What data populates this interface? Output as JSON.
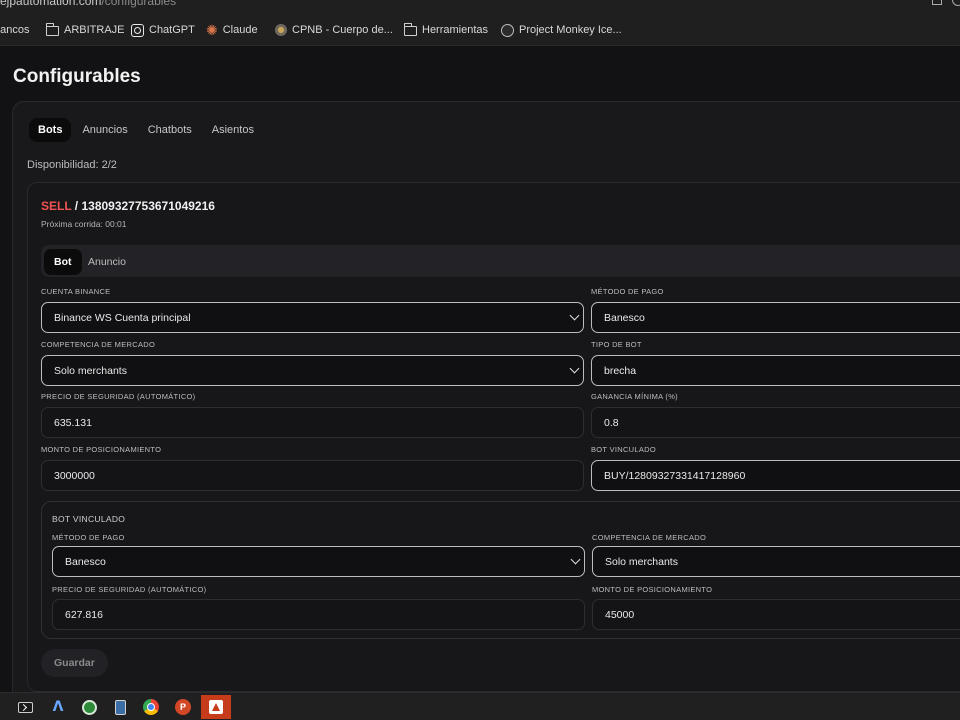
{
  "browser": {
    "url_main": "ejpautomation.com",
    "url_path": "/configurables",
    "bookmarks": [
      {
        "icon": "folder-icon",
        "label": "bancos"
      },
      {
        "icon": "folder-icon",
        "label": "ARBITRAJE"
      },
      {
        "icon": "chatgpt-icon",
        "label": "ChatGPT"
      },
      {
        "icon": "claude-icon",
        "label": "Claude"
      },
      {
        "icon": "cpnb-icon",
        "label": "CPNB - Cuerpo de..."
      },
      {
        "icon": "folder-icon",
        "label": "Herramientas"
      },
      {
        "icon": "project-monkey-icon",
        "label": "Project Monkey Ice..."
      }
    ]
  },
  "page": {
    "title": "Configurables",
    "tabs": [
      "Bots",
      "Anuncios",
      "Chatbots",
      "Asientos"
    ],
    "active_tab": "Bots",
    "availability": "Disponibilidad: 2/2"
  },
  "bot": {
    "side": "SELL",
    "separator": " / ",
    "id": "1380932775367104921​6",
    "next_run": "Próxima corrida: 00:01",
    "subtabs": [
      "Bot",
      "Anuncio"
    ],
    "active_subtab": "Bot",
    "form": {
      "cuenta_binance": {
        "label": "Cuenta Binance",
        "value": "Binance WS Cuenta principal"
      },
      "metodo_pago": {
        "label": "Método de pago",
        "value": "Banesco"
      },
      "competencia": {
        "label": "Competencia de mercado",
        "value": "Solo merchants"
      },
      "tipo_bot": {
        "label": "Tipo de bot",
        "value": "brecha"
      },
      "precio_seguridad": {
        "label": "Precio de seguridad (automático)",
        "value": "635.131"
      },
      "ganancia_minima": {
        "label": "Ganancia mínima (%)",
        "value": "0.8"
      },
      "monto_posicionamiento": {
        "label": "Monto de posicionamiento",
        "value": "3000000"
      },
      "bot_vinculado": {
        "label": "Bot vinculado",
        "value": "BUY/12809327331417128960"
      }
    },
    "linked": {
      "title": "Bot vinculado",
      "metodo_pago": {
        "label": "Método de pago",
        "value": "Banesco"
      },
      "competencia": {
        "label": "Competencia de mercado",
        "value": "Solo merchants"
      },
      "precio_seguridad": {
        "label": "Precio de seguridad (automático)",
        "value": "627.816"
      },
      "monto_posicionamiento": {
        "label": "Monto de posicionamiento",
        "value": "45000"
      }
    },
    "save_label": "Guardar"
  },
  "taskbar": {
    "apps": [
      "terminal-icon",
      "arc-icon",
      "green-app-icon",
      "calculator-icon",
      "chrome-icon",
      "powerpoint-icon",
      "red-app-icon"
    ],
    "active_app": "red-app-icon"
  },
  "colors": {
    "sell": "#ef5350",
    "background": "#121214",
    "active_task": "#c63c1b"
  }
}
